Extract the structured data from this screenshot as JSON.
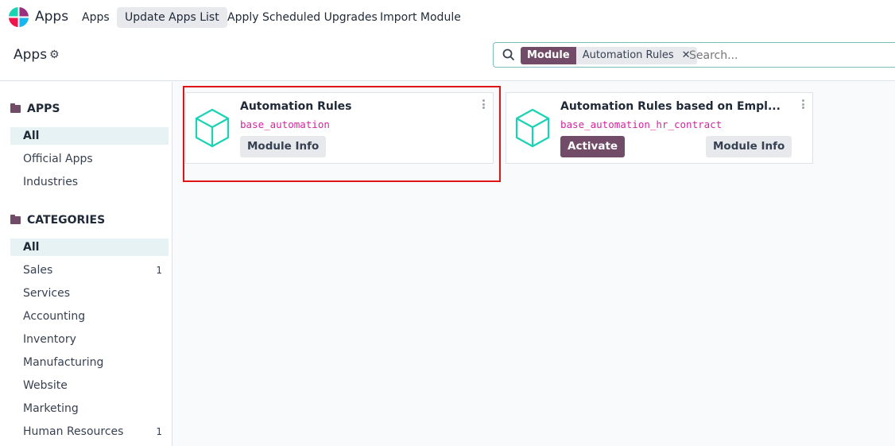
{
  "navbar": {
    "brand": "Apps",
    "menus": [
      {
        "label": "Apps"
      },
      {
        "label": "Update Apps List",
        "active": true
      },
      {
        "label": "Apply Scheduled Upgrades"
      },
      {
        "label": "Import Module"
      }
    ]
  },
  "control_panel": {
    "title": "Apps",
    "gear_icon": "gear-icon"
  },
  "search": {
    "facet_key": "Module",
    "facet_value": "Automation Rules",
    "placeholder": "Search..."
  },
  "sidebar": {
    "apps_header": "APPS",
    "apps_items": [
      {
        "label": "All",
        "selected": true
      },
      {
        "label": "Official Apps"
      },
      {
        "label": "Industries"
      }
    ],
    "categories_header": "CATEGORIES",
    "categories": [
      {
        "label": "All",
        "selected": true
      },
      {
        "label": "Sales",
        "count": "1"
      },
      {
        "label": "Services"
      },
      {
        "label": "Accounting"
      },
      {
        "label": "Inventory"
      },
      {
        "label": "Manufacturing"
      },
      {
        "label": "Website"
      },
      {
        "label": "Marketing"
      },
      {
        "label": "Human Resources",
        "count": "1"
      }
    ]
  },
  "cards": [
    {
      "title": "Automation Rules",
      "technical_name": "base_automation",
      "info_label": "Module Info",
      "highlighted": true
    },
    {
      "title": "Automation Rules based on Empl...",
      "technical_name": "base_automation_hr_contract",
      "activate_label": "Activate",
      "info_label": "Module Info"
    }
  ],
  "colors": {
    "brand": "#714b67",
    "accent": "#1ad3b5",
    "tech_name": "#d6249f",
    "highlight": "#e01414"
  }
}
